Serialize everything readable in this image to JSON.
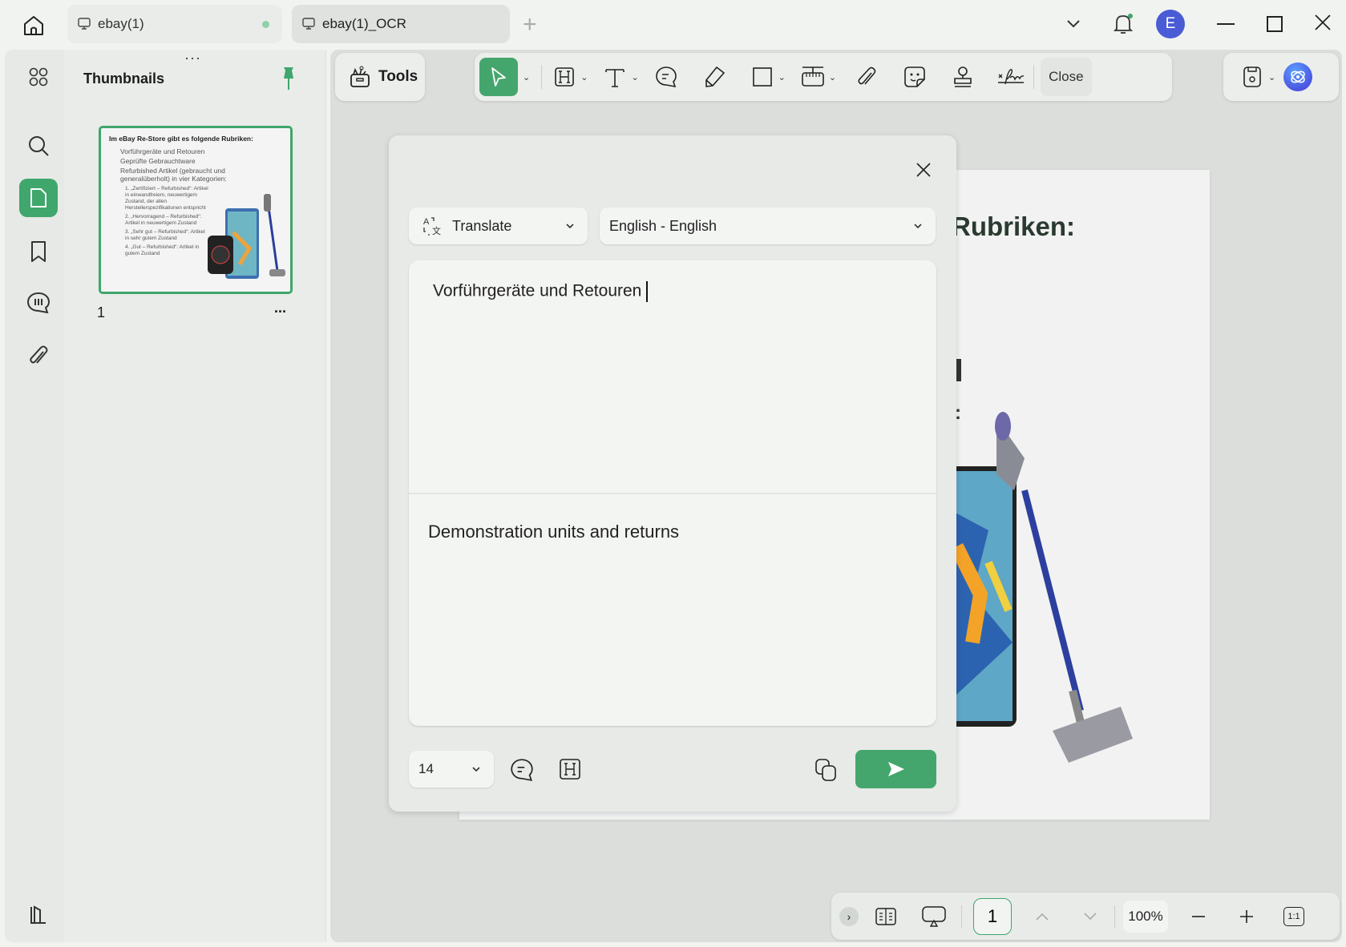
{
  "tabs": [
    {
      "label": "ebay(1)",
      "unsaved": true
    },
    {
      "label": "ebay(1)_OCR",
      "active": true
    }
  ],
  "user": {
    "initial": "E",
    "color": "#4a5bd6"
  },
  "accent": "#3fa66c",
  "thumbnails": {
    "title": "Thumbnails",
    "page_label": "1",
    "more": "...",
    "preview": {
      "heading": "Im eBay Re-Store gibt es folgende Rubriken:",
      "bullets": [
        "Vorführgeräte und Retouren",
        "Geprüfte Gebrauchtware",
        "Refurbished Artikel (gebraucht und generalüberholt) in vier Kategorien:"
      ],
      "items": [
        "1. „Zertifiziert – Refurbished“: Artikel in einwandfreiem, neuwertigem Zustand, der allen Herstellerspezifikationen entspricht",
        "2. „Hervorragend – Refurbished“: Artikel in neuwertigem Zustand",
        "3. „Sehr gut – Refurbished“: Artikel in sehr gutem Zustand",
        "4. „Gut – Refurbished“: Artikel in gutem Zustand"
      ]
    }
  },
  "toolbar": {
    "tools_label": "Tools",
    "close_label": "Close"
  },
  "document": {
    "visible_heading": "Rubriken:"
  },
  "dialog": {
    "mode": "Translate",
    "language": "English - English",
    "source_text": "Vorführgeräte und Retouren",
    "result_text": "Demonstration units and returns",
    "font_size": "14"
  },
  "bottom": {
    "page": "1",
    "zoom": "100%",
    "actual_size": "1:1"
  }
}
